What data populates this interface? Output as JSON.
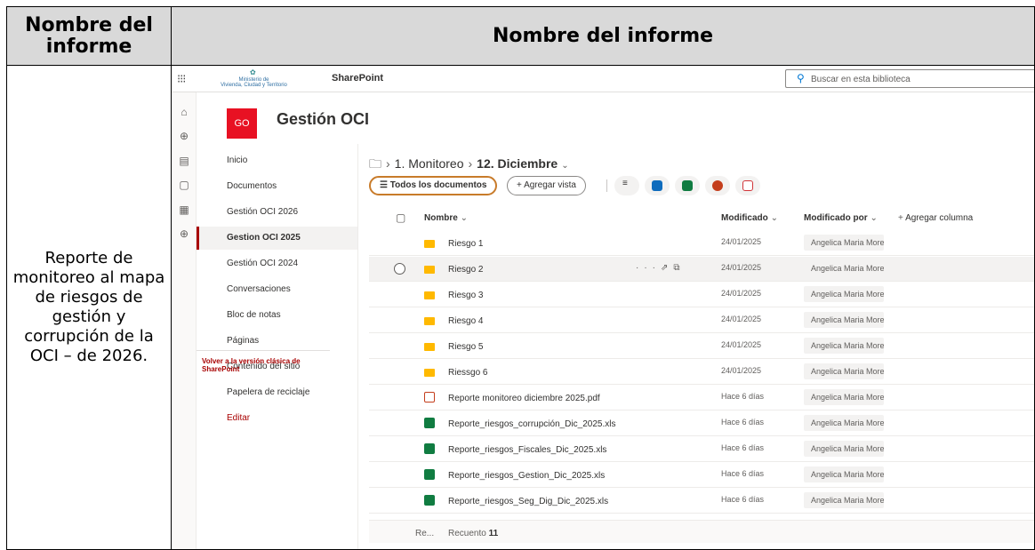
{
  "doc": {
    "header_left": "Nombre del informe",
    "header_right": "Nombre del informe",
    "description": "Reporte de monitoreo al mapa de riesgos de gestión y corrupción de la OCI – de 2026."
  },
  "topbar": {
    "ministry_lines": [
      "Ministerio de",
      "Vivienda, Ciudad y Territorio"
    ],
    "brand": "SharePoint",
    "search_placeholder": "Buscar en esta biblioteca"
  },
  "site": {
    "logo_text": "GO",
    "title": "Gestión OCI",
    "colors": {
      "logo": "#e81123",
      "accent": "#a80000",
      "selected_view": "#c87b2a"
    }
  },
  "nav": {
    "items": [
      {
        "label": "Inicio"
      },
      {
        "label": "Documentos"
      },
      {
        "label": "Gestión OCI 2026"
      },
      {
        "label": "Gestion OCI 2025",
        "active": true
      },
      {
        "label": "Gestión OCI 2024"
      },
      {
        "label": "Conversaciones"
      },
      {
        "label": "Bloc de notas"
      },
      {
        "label": "Páginas"
      },
      {
        "label": "Contenido del sitio"
      },
      {
        "label": "Papelera de reciclaje"
      },
      {
        "label": "Editar"
      }
    ],
    "classic_link": "Volver a la versión clásica de SharePoint"
  },
  "breadcrumb": {
    "parent": "1. Monitoreo",
    "current": "12. Diciembre"
  },
  "commands": {
    "view_all": "Todos los documentos",
    "add_view": "Agregar vista",
    "apps": [
      {
        "name": "outlook-icon",
        "color": "#0f6cbd"
      },
      {
        "name": "excel-icon",
        "color": "#107c41"
      },
      {
        "name": "powerpoint-icon",
        "color": "#c43e1c"
      },
      {
        "name": "pdf-icon",
        "color": "#d13438"
      }
    ]
  },
  "columns": {
    "name": "Nombre",
    "modified": "Modificado",
    "modified_by": "Modificado por",
    "add_column": "Agregar columna"
  },
  "rows": [
    {
      "type": "folder",
      "name": "Riesgo 1",
      "modified": "24/01/2025",
      "by": "Angelica Maria Morer"
    },
    {
      "type": "folder",
      "name": "Riesgo 2",
      "modified": "24/01/2025",
      "by": "Angelica Maria Morer",
      "hover": true
    },
    {
      "type": "folder",
      "name": "Riesgo 3",
      "modified": "24/01/2025",
      "by": "Angelica Maria Morer"
    },
    {
      "type": "folder",
      "name": "Riesgo 4",
      "modified": "24/01/2025",
      "by": "Angelica Maria Morer"
    },
    {
      "type": "folder",
      "name": "Riesgo 5",
      "modified": "24/01/2025",
      "by": "Angelica Maria Morer"
    },
    {
      "type": "folder",
      "name": "Riessgo 6",
      "modified": "24/01/2025",
      "by": "Angelica Maria Morer"
    },
    {
      "type": "pdf",
      "name": "Reporte monitoreo diciembre 2025.pdf",
      "modified": "Hace 6 días",
      "by": "Angelica Maria Morer"
    },
    {
      "type": "xls",
      "name": "Reporte_riesgos_corrupción_Dic_2025.xls",
      "modified": "Hace 6 días",
      "by": "Angelica Maria Morer"
    },
    {
      "type": "xls",
      "name": "Reporte_riesgos_Fiscales_Dic_2025.xls",
      "modified": "Hace 6 días",
      "by": "Angelica Maria Morer"
    },
    {
      "type": "xls",
      "name": "Reporte_riesgos_Gestion_Dic_2025.xls",
      "modified": "Hace 6 días",
      "by": "Angelica Maria Morer"
    },
    {
      "type": "xls",
      "name": "Reporte_riesgos_Seg_Dig_Dic_2025.xls",
      "modified": "Hace 6 días",
      "by": "Angelica Maria Morer"
    }
  ],
  "footer": {
    "prefix": "Re...",
    "count_label": "Recuento",
    "count": "11"
  }
}
